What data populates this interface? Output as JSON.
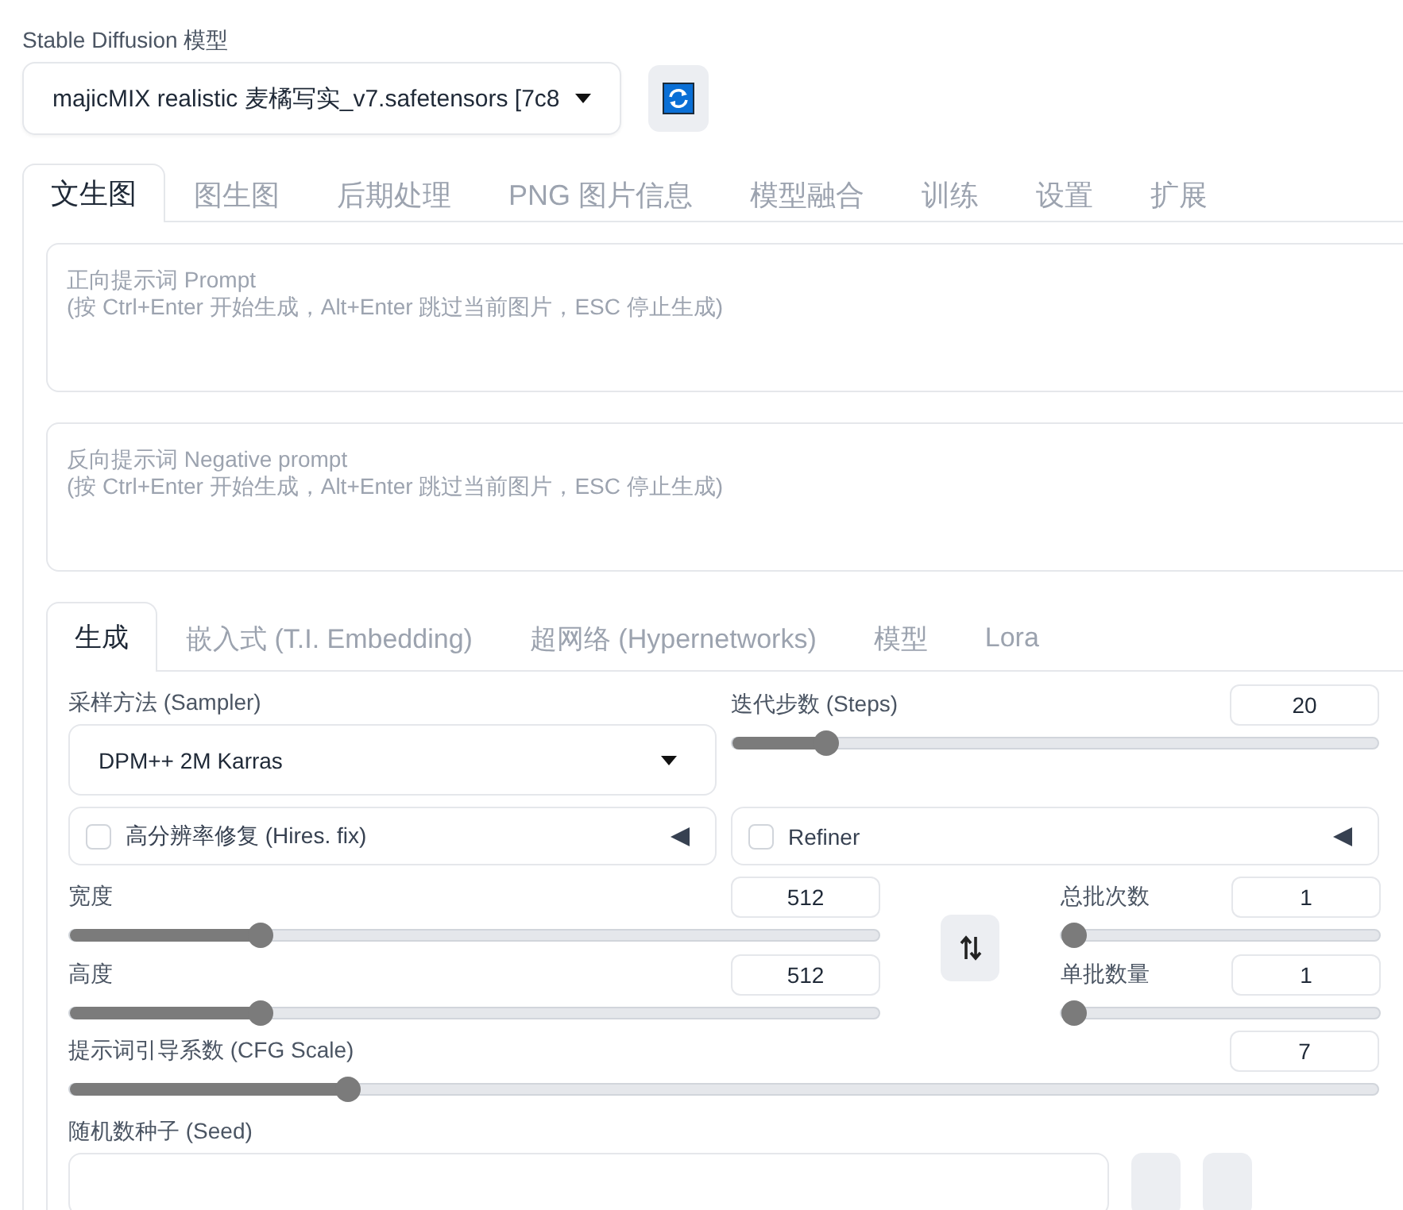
{
  "model": {
    "label": "Stable Diffusion 模型",
    "value": "majicMIX realistic 麦橘写实_v7.safetensors [7c8"
  },
  "main_tabs": [
    {
      "label": "文生图",
      "selected": true
    },
    {
      "label": "图生图",
      "selected": false
    },
    {
      "label": "后期处理",
      "selected": false
    },
    {
      "label": "PNG 图片信息",
      "selected": false
    },
    {
      "label": "模型融合",
      "selected": false
    },
    {
      "label": "训练",
      "selected": false
    },
    {
      "label": "设置",
      "selected": false
    },
    {
      "label": "扩展",
      "selected": false
    }
  ],
  "prompts": [
    {
      "placeholder": "正向提示词 Prompt\n(按 Ctrl+Enter 开始生成，Alt+Enter 跳过当前图片，ESC 停止生成)"
    },
    {
      "placeholder": "反向提示词 Negative prompt\n(按 Ctrl+Enter 开始生成，Alt+Enter 跳过当前图片，ESC 停止生成)"
    }
  ],
  "sub_tabs": [
    {
      "label": "生成",
      "selected": true
    },
    {
      "label": "嵌入式 (T.I. Embedding)",
      "selected": false
    },
    {
      "label": "超网络 (Hypernetworks)",
      "selected": false
    },
    {
      "label": "模型",
      "selected": false
    },
    {
      "label": "Lora",
      "selected": false
    }
  ],
  "sampler": {
    "label": "采样方法 (Sampler)",
    "value": "DPM++ 2M Karras"
  },
  "steps": {
    "label": "迭代步数 (Steps)",
    "value": "20",
    "level": 0.145
  },
  "accordions": [
    {
      "label": "高分辨率修复 (Hires. fix)",
      "checked": false,
      "expanded": false
    },
    {
      "label": "Refiner",
      "checked": false,
      "expanded": false
    }
  ],
  "width": {
    "label": "宽度",
    "value": "512",
    "level": 0.235
  },
  "height": {
    "label": "高度",
    "value": "512",
    "level": 0.235
  },
  "batch_count": {
    "label": "总批次数",
    "value": "1",
    "level": 0
  },
  "batch_size": {
    "label": "单批数量",
    "value": "1",
    "level": 0
  },
  "cfg_scale": {
    "label": "提示词引导系数 (CFG Scale)",
    "value": "7",
    "level": 0.213
  },
  "seed": {
    "label": "随机数种子 (Seed)"
  }
}
